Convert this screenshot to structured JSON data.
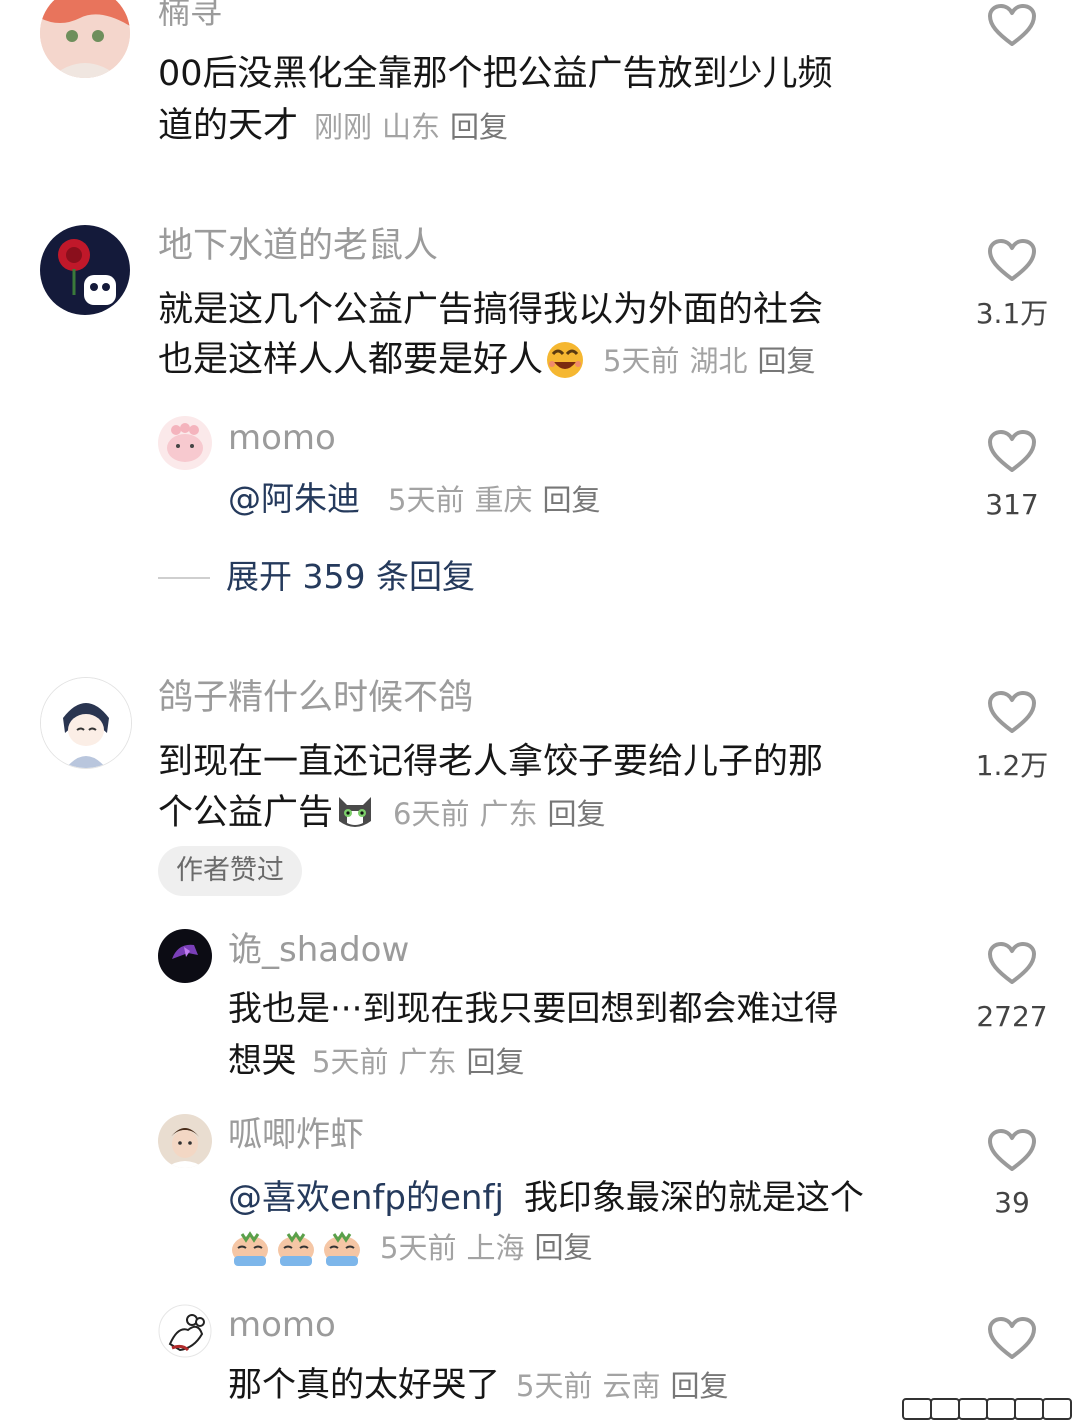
{
  "icons": {
    "like": "heart-outline-icon"
  },
  "comments": [
    {
      "username": "楠寻",
      "text_line1": "00后没黑化全靠那个把公益广告放到少儿频",
      "text_line2": "道的天才",
      "time": "刚刚",
      "location": "山东",
      "reply": "回复",
      "likes": ""
    },
    {
      "username": "地下水道的老鼠人",
      "text_line1": "就是这几个公益广告搞得我以为外面的社会",
      "text_line2": "也是这样人人都要是好人",
      "emoji": "laughing-emoji",
      "time": "5天前",
      "location": "湖北",
      "reply": "回复",
      "likes": "3.1万",
      "replies": [
        {
          "username": "momo",
          "mention": "@阿朱迪",
          "time": "5天前",
          "location": "重庆",
          "reply": "回复",
          "likes": "317"
        }
      ],
      "expand_label": "展开 359 条回复"
    },
    {
      "username": "鸽子精什么时候不鸽",
      "text_line1": "到现在一直还记得老人拿饺子要给儿子的那",
      "text_line2": "个公益广告",
      "emoji": "cat-emoji",
      "time": "6天前",
      "location": "广东",
      "reply": "回复",
      "likes": "1.2万",
      "badge": "作者赞过",
      "replies": [
        {
          "username": "诡_shadow",
          "text_line1": "我也是···到现在我只要回想到都会难过得",
          "text_line2": "想哭",
          "time": "5天前",
          "location": "广东",
          "reply": "回复",
          "likes": "2727"
        },
        {
          "username": "呱唧炸虾",
          "mention": "@喜欢enfp的enfj",
          "text_line1": "我印象最深的就是这个",
          "emoji": "crying-emoji",
          "time": "5天前",
          "location": "上海",
          "reply": "回复",
          "likes": "39"
        },
        {
          "username": "momo",
          "text_line1": "那个真的太好哭了",
          "time": "5天前",
          "location": "云南",
          "reply": "回复",
          "likes": ""
        }
      ]
    }
  ]
}
